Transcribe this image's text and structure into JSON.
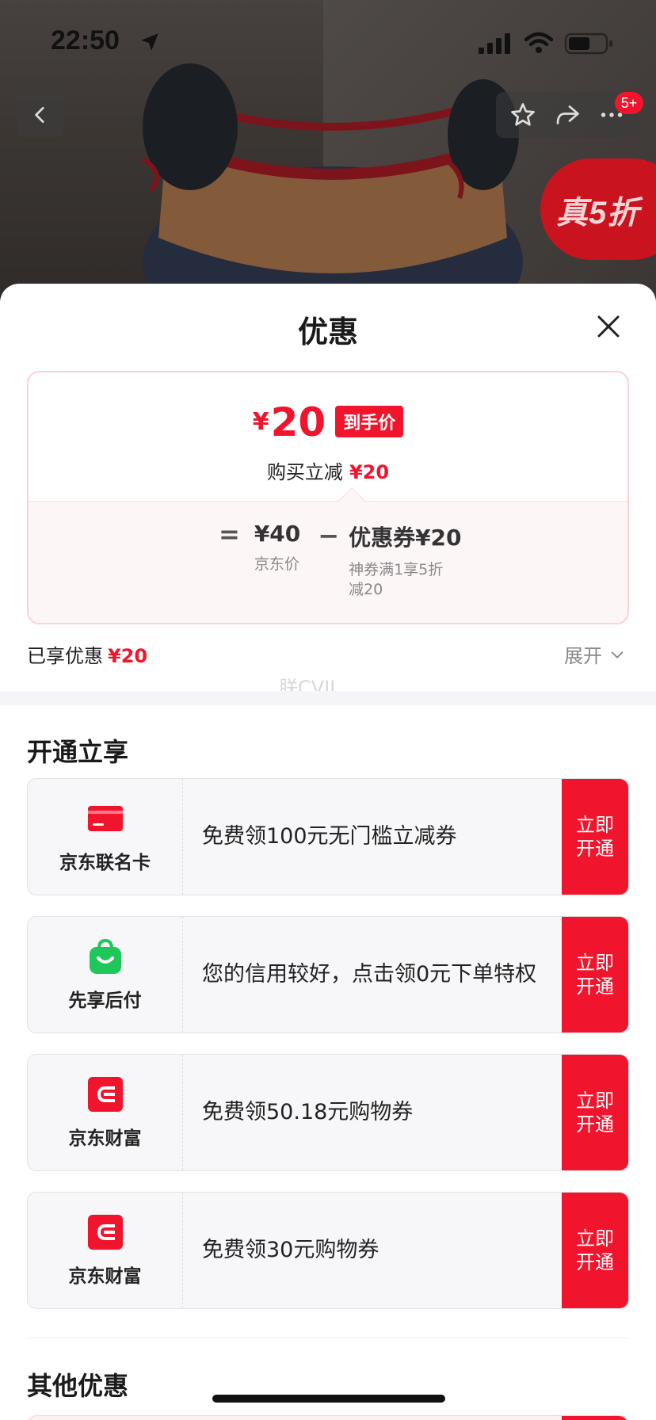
{
  "status_bar": {
    "time": "22:50"
  },
  "nav": {
    "badge": "5+"
  },
  "promo_tag": "真5折",
  "sheet": {
    "title": "优惠",
    "price_card": {
      "currency": "¥",
      "amount": "20",
      "tag": "到手价",
      "subtitle_label": "购买立减",
      "subtitle_value": "¥20",
      "formula": {
        "equals": "=",
        "jd_price_value": "¥40",
        "jd_price_label": "京东价",
        "minus": "−",
        "coupon_value": "优惠券¥20",
        "coupon_label_line1": "神券满1享5折",
        "coupon_label_line2": "减20"
      }
    },
    "enjoyed_label": "已享优惠",
    "enjoyed_value": "¥20",
    "expand_label": "展开",
    "watermark": "朕CVIL",
    "open_section_title": "开通立享",
    "offers": [
      {
        "brand": "京东联名卡",
        "icon": "card-icon",
        "desc": "免费领100元无门槛立减券",
        "btn_line1": "立即",
        "btn_line2": "开通"
      },
      {
        "brand": "先享后付",
        "icon": "shopping-bag-icon",
        "desc": "您的信用较好，点击领0元下单特权",
        "btn_line1": "立即",
        "btn_line2": "开通"
      },
      {
        "brand": "京东财富",
        "icon": "wallet-icon",
        "desc": "免费领50.18元购物券",
        "btn_line1": "立即",
        "btn_line2": "开通"
      },
      {
        "brand": "京东财富",
        "icon": "wallet-icon",
        "desc": "免费领30元购物券",
        "btn_line1": "立即",
        "btn_line2": "开通"
      }
    ],
    "other_section_title": "其他优惠"
  },
  "colors": {
    "accent": "#f0142c",
    "card_border": "#f8d2d7",
    "green": "#1fc65a"
  }
}
